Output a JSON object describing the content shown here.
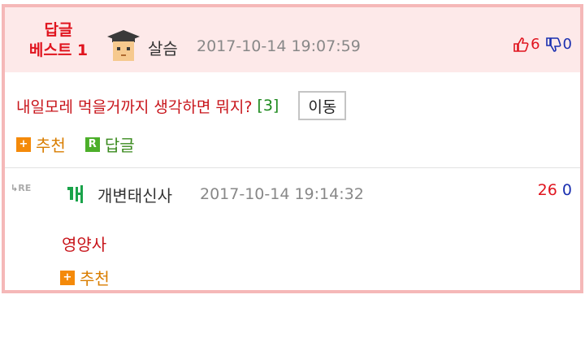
{
  "best": {
    "line1": "답글",
    "line2": "베스트 1"
  },
  "post": {
    "author": "살슴",
    "datetime": "2017-10-14 19:07:59",
    "upvotes": "6",
    "downvotes": "0",
    "title": "내일모레 먹을거까지 생각하면 뭐지?",
    "reply_count": "[3]",
    "move_label": "이동",
    "recommend_label": "추천",
    "reply_label": "답글"
  },
  "reply": {
    "re_label": "RE",
    "author": "개변태신사",
    "datetime": "2017-10-14 19:14:32",
    "upvotes": "26",
    "downvotes": "0",
    "body": "영양사",
    "recommend_label": "추천"
  },
  "colors": {
    "accent": "#e0141e",
    "header_bg": "#fde9e9",
    "border": "#f5b8b8",
    "orange": "#f48a0a",
    "green": "#4caf2a"
  },
  "icons": [
    "avatar-graduate-icon",
    "thumbs-up-icon",
    "thumbs-down-icon",
    "plus-icon",
    "reply-r-icon",
    "reply-arrow-icon",
    "level-icon"
  ]
}
